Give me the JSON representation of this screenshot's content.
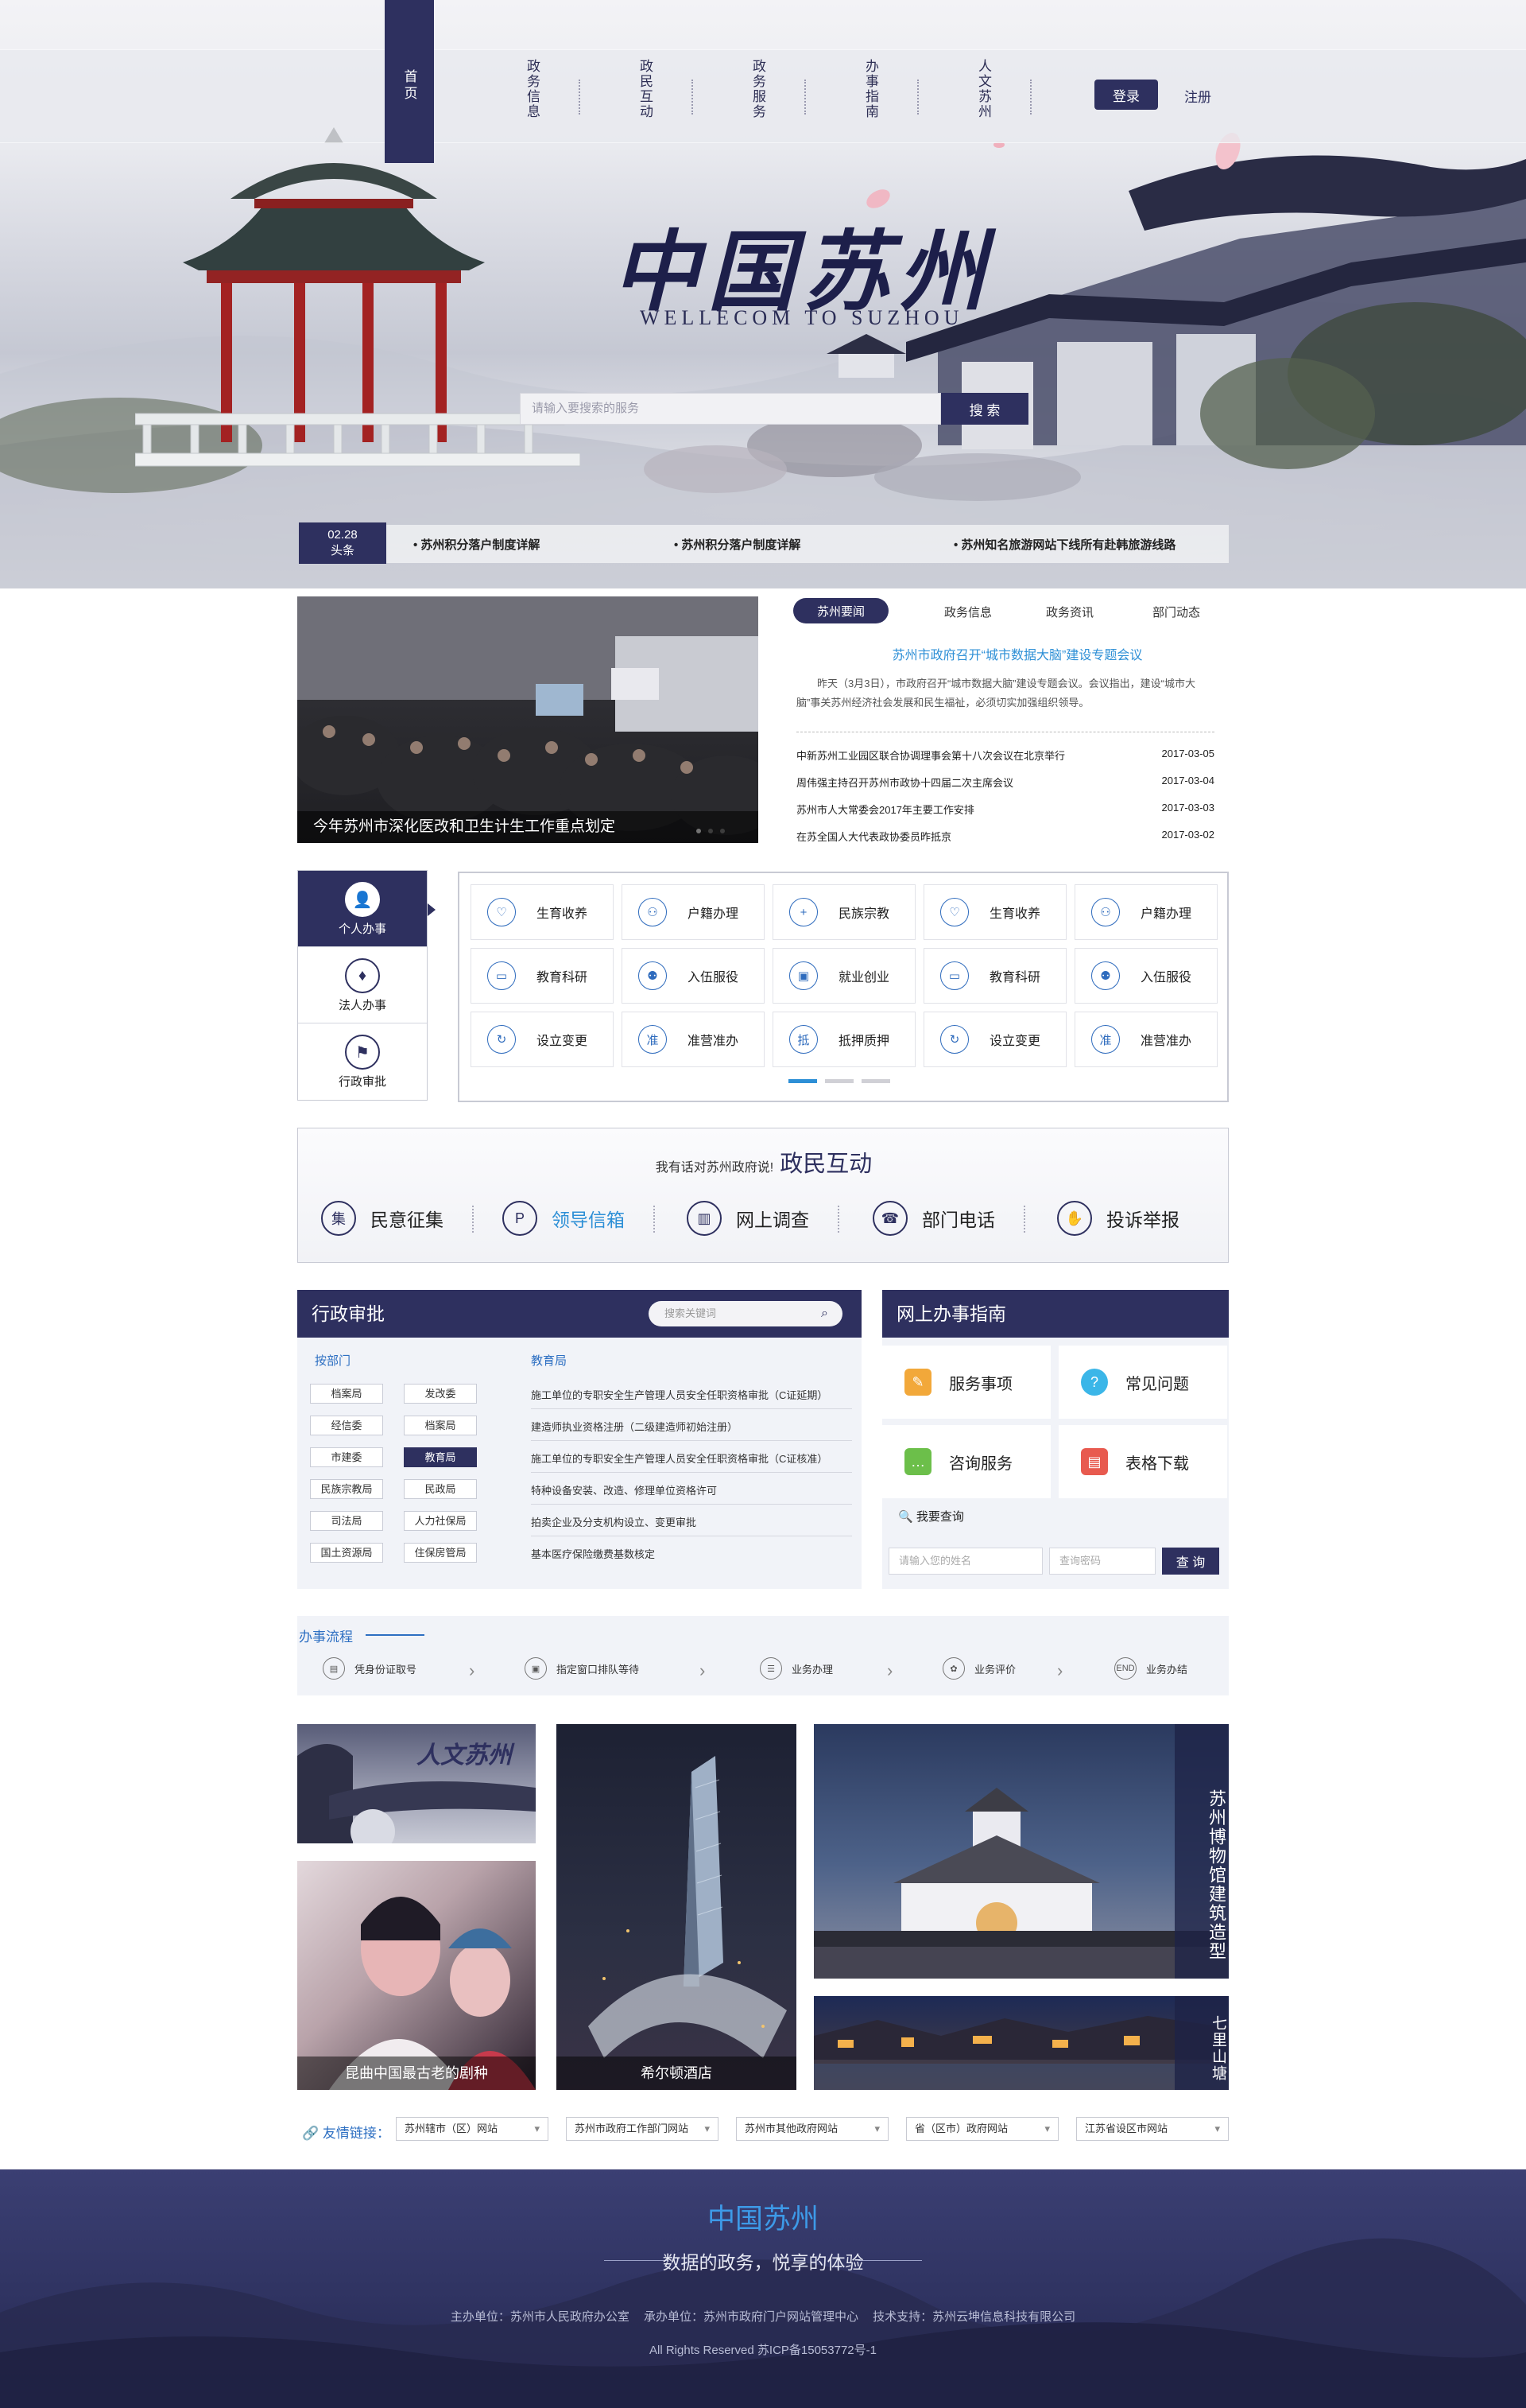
{
  "nav": {
    "home": "首页",
    "items": [
      "政务信息",
      "政民互动",
      "政务服务",
      "办事指南",
      "人文苏州"
    ],
    "login": "登录",
    "register": "注册"
  },
  "hero": {
    "title_cn": "中国苏州",
    "title_en": "WELLECOM TO SUZHOU",
    "search_placeholder": "请输入要搜索的服务",
    "search_button": "搜 索"
  },
  "ticker": {
    "date": "02.28",
    "tag": "头条",
    "items": [
      "• 苏州积分落户制度详解",
      "• 苏州积分落户制度详解",
      "• 苏州知名旅游网站下线所有赴韩旅游线路"
    ]
  },
  "news": {
    "image_caption": "今年苏州市深化医改和卫生计生工作重点划定",
    "tabs": [
      "苏州要闻",
      "政务信息",
      "政务资讯",
      "部门动态"
    ],
    "headline": "苏州市政府召开“城市数据大脑”建设专题会议",
    "summary": "昨天（3月3日），市政府召开“城市数据大脑”建设专题会议。会议指出，建设“城市大脑”事关苏州经济社会发展和民生福祉，必须切实加强组织领导。",
    "list": [
      {
        "title": "中新苏州工业园区联合协调理事会第十八次会议在北京举行",
        "date": "2017-03-05"
      },
      {
        "title": "周伟强主持召开苏州市政协十四届二次主席会议",
        "date": "2017-03-04"
      },
      {
        "title": "苏州市人大常委会2017年主要工作安排",
        "date": "2017-03-03"
      },
      {
        "title": "在苏全国人大代表政协委员昨抵京",
        "date": "2017-03-02"
      }
    ]
  },
  "services": {
    "categories": [
      "个人办事",
      "法人办事",
      "行政审批"
    ],
    "grid": [
      [
        "生育收养",
        "户籍办理",
        "民族宗教",
        "生育收养",
        "户籍办理"
      ],
      [
        "教育科研",
        "入伍服役",
        "就业创业",
        "教育科研",
        "入伍服役"
      ],
      [
        "设立变更",
        "准营准办",
        "抵押质押",
        "设立变更",
        "准营准办"
      ]
    ],
    "icon_glyphs": [
      [
        "♡",
        "⚇",
        "+",
        "♡",
        "⚇"
      ],
      [
        "▭",
        "⚉",
        "▣",
        "▭",
        "⚉"
      ],
      [
        "↻",
        "准",
        "抵",
        "↻",
        "准"
      ]
    ]
  },
  "interaction": {
    "lead": "我有话对苏州政府说!",
    "title": "政民互动",
    "items": [
      "民意征集",
      "领导信箱",
      "网上调查",
      "部门电话",
      "投诉举报"
    ],
    "icons": [
      "集",
      "P",
      "▥",
      "☎",
      "✋"
    ]
  },
  "approval": {
    "title": "行政审批",
    "search_placeholder": "搜索关键词",
    "by_dept_label": "按部门",
    "depts": [
      "档案局",
      "发改委",
      "经信委",
      "档案局",
      "市建委",
      "教育局",
      "民族宗教局",
      "民政局",
      "司法局",
      "人力社保局",
      "国土资源局",
      "住保房管局"
    ],
    "selected_dept_label": "教育局",
    "items": [
      "施工单位的专职安全生产管理人员安全任职资格审批（C证延期）",
      "建造师执业资格注册（二级建造师初始注册）",
      "施工单位的专职安全生产管理人员安全任职资格审批（C证核准）",
      "特种设备安装、改造、修理单位资格许可",
      "拍卖企业及分支机构设立、变更审批",
      "基本医疗保险缴费基数核定"
    ]
  },
  "guide": {
    "title": "网上办事指南",
    "cells": [
      "服务事项",
      "常见问题",
      "咨询服务",
      "表格下载"
    ],
    "cell_colors": [
      "#f2a83a",
      "#3bb6e8",
      "#6cbf4a",
      "#e85a4f"
    ],
    "cell_icons": [
      "✎",
      "?",
      "…",
      "▤"
    ],
    "query_label": "我要查询",
    "name_placeholder": "请输入您的姓名",
    "pwd_placeholder": "查询密码",
    "query_button": "查 询"
  },
  "process": {
    "title": "办事流程",
    "steps": [
      "凭身份证取号",
      "指定窗口排队等待",
      "业务办理",
      "业务评价",
      "业务办结"
    ],
    "icons": [
      "▤",
      "▣",
      "☰",
      "✿",
      "END"
    ]
  },
  "gallery": {
    "renwen": "人文苏州",
    "kunqu": "昆曲中国最古老的剧种",
    "hilton": "希尔顿酒店",
    "museum": "苏州博物馆建筑造型",
    "shantang": "七里山塘"
  },
  "links": {
    "label": "友情链接：",
    "selects": [
      "苏州辖市（区）网站",
      "苏州市政府工作部门网站",
      "苏州市其他政府网站",
      "省（区市）政府网站",
      "江苏省设区市网站"
    ]
  },
  "footer": {
    "title": "中国苏州",
    "subtitle": "数据的政务，悦享的体验",
    "info": "主办单位：苏州市人民政府办公室 承办单位：苏州市政府门户网站管理中心 技术支持：苏州云坤信息科技有限公司",
    "copyright": "All Rights Reserved 苏ICP备15053772号-1"
  }
}
